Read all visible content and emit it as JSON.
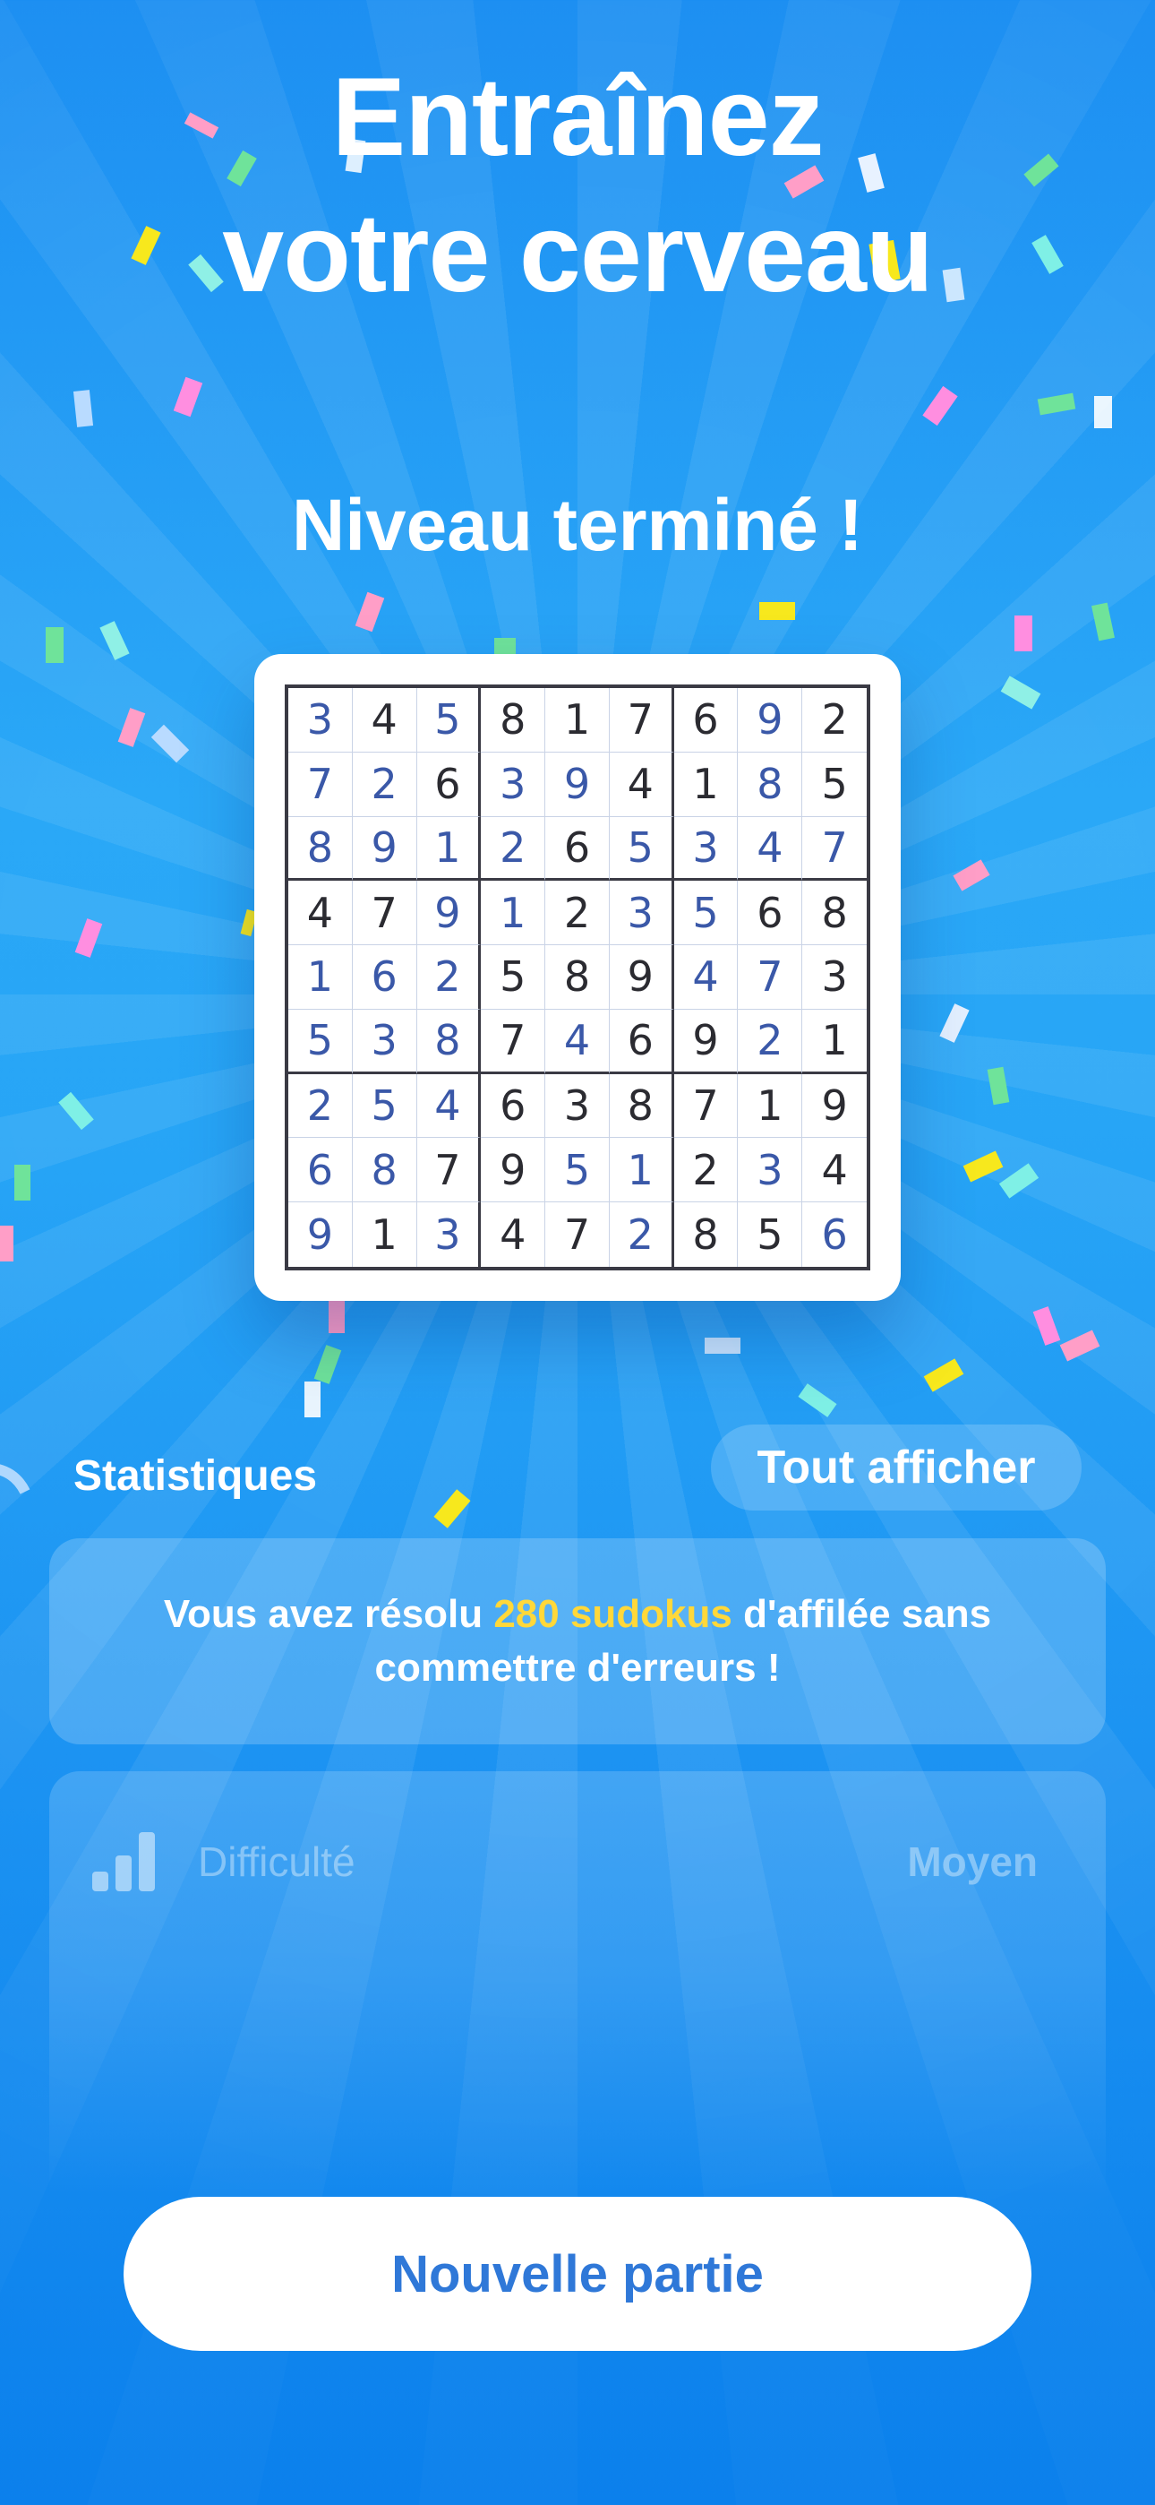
{
  "colors": {
    "background_top": "#1d8ff2",
    "background_bottom": "#0b80ec",
    "highlight": "#ffd83a",
    "given_digit": "#2b2b31",
    "solved_digit": "#3a58a8",
    "button_text": "#2f78d8"
  },
  "header": {
    "line1": "Entraînez",
    "line2": "votre cerveau"
  },
  "status": {
    "title": "Niveau terminé !"
  },
  "board": {
    "rows": [
      [
        {
          "v": "3",
          "s": 1
        },
        {
          "v": "4",
          "s": 0
        },
        {
          "v": "5",
          "s": 1
        },
        {
          "v": "8",
          "s": 0
        },
        {
          "v": "1",
          "s": 0
        },
        {
          "v": "7",
          "s": 0
        },
        {
          "v": "6",
          "s": 0
        },
        {
          "v": "9",
          "s": 1
        },
        {
          "v": "2",
          "s": 0
        }
      ],
      [
        {
          "v": "7",
          "s": 1
        },
        {
          "v": "2",
          "s": 1
        },
        {
          "v": "6",
          "s": 0
        },
        {
          "v": "3",
          "s": 1
        },
        {
          "v": "9",
          "s": 1
        },
        {
          "v": "4",
          "s": 0
        },
        {
          "v": "1",
          "s": 0
        },
        {
          "v": "8",
          "s": 1
        },
        {
          "v": "5",
          "s": 0
        }
      ],
      [
        {
          "v": "8",
          "s": 1
        },
        {
          "v": "9",
          "s": 1
        },
        {
          "v": "1",
          "s": 1
        },
        {
          "v": "2",
          "s": 1
        },
        {
          "v": "6",
          "s": 0
        },
        {
          "v": "5",
          "s": 1
        },
        {
          "v": "3",
          "s": 1
        },
        {
          "v": "4",
          "s": 1
        },
        {
          "v": "7",
          "s": 1
        }
      ],
      [
        {
          "v": "4",
          "s": 0
        },
        {
          "v": "7",
          "s": 0
        },
        {
          "v": "9",
          "s": 1
        },
        {
          "v": "1",
          "s": 1
        },
        {
          "v": "2",
          "s": 0
        },
        {
          "v": "3",
          "s": 1
        },
        {
          "v": "5",
          "s": 1
        },
        {
          "v": "6",
          "s": 0
        },
        {
          "v": "8",
          "s": 0
        }
      ],
      [
        {
          "v": "1",
          "s": 1
        },
        {
          "v": "6",
          "s": 1
        },
        {
          "v": "2",
          "s": 1
        },
        {
          "v": "5",
          "s": 0
        },
        {
          "v": "8",
          "s": 0
        },
        {
          "v": "9",
          "s": 0
        },
        {
          "v": "4",
          "s": 1
        },
        {
          "v": "7",
          "s": 1
        },
        {
          "v": "3",
          "s": 0
        }
      ],
      [
        {
          "v": "5",
          "s": 1
        },
        {
          "v": "3",
          "s": 1
        },
        {
          "v": "8",
          "s": 1
        },
        {
          "v": "7",
          "s": 0
        },
        {
          "v": "4",
          "s": 1
        },
        {
          "v": "6",
          "s": 0
        },
        {
          "v": "9",
          "s": 0
        },
        {
          "v": "2",
          "s": 1
        },
        {
          "v": "1",
          "s": 0
        }
      ],
      [
        {
          "v": "2",
          "s": 1
        },
        {
          "v": "5",
          "s": 1
        },
        {
          "v": "4",
          "s": 1
        },
        {
          "v": "6",
          "s": 0
        },
        {
          "v": "3",
          "s": 0
        },
        {
          "v": "8",
          "s": 0
        },
        {
          "v": "7",
          "s": 0
        },
        {
          "v": "1",
          "s": 0
        },
        {
          "v": "9",
          "s": 0
        }
      ],
      [
        {
          "v": "6",
          "s": 1
        },
        {
          "v": "8",
          "s": 1
        },
        {
          "v": "7",
          "s": 0
        },
        {
          "v": "9",
          "s": 0
        },
        {
          "v": "5",
          "s": 1
        },
        {
          "v": "1",
          "s": 1
        },
        {
          "v": "2",
          "s": 0
        },
        {
          "v": "3",
          "s": 1
        },
        {
          "v": "4",
          "s": 0
        }
      ],
      [
        {
          "v": "9",
          "s": 1
        },
        {
          "v": "1",
          "s": 0
        },
        {
          "v": "3",
          "s": 1
        },
        {
          "v": "4",
          "s": 0
        },
        {
          "v": "7",
          "s": 0
        },
        {
          "v": "2",
          "s": 1
        },
        {
          "v": "8",
          "s": 0
        },
        {
          "v": "5",
          "s": 0
        },
        {
          "v": "6",
          "s": 1
        }
      ]
    ]
  },
  "stats": {
    "title": "Statistiques",
    "view_all_label": "Tout afficher",
    "streak_before": "Vous avez résolu ",
    "streak_highlight": "280 sudokus",
    "streak_after": " d'affilée sans commettre d'erreurs !",
    "difficulty_label": "Difficulté",
    "difficulty_value": "Moyen",
    "difficulty_icon": "bar-chart-icon"
  },
  "actions": {
    "new_game_label": "Nouvelle partie"
  }
}
